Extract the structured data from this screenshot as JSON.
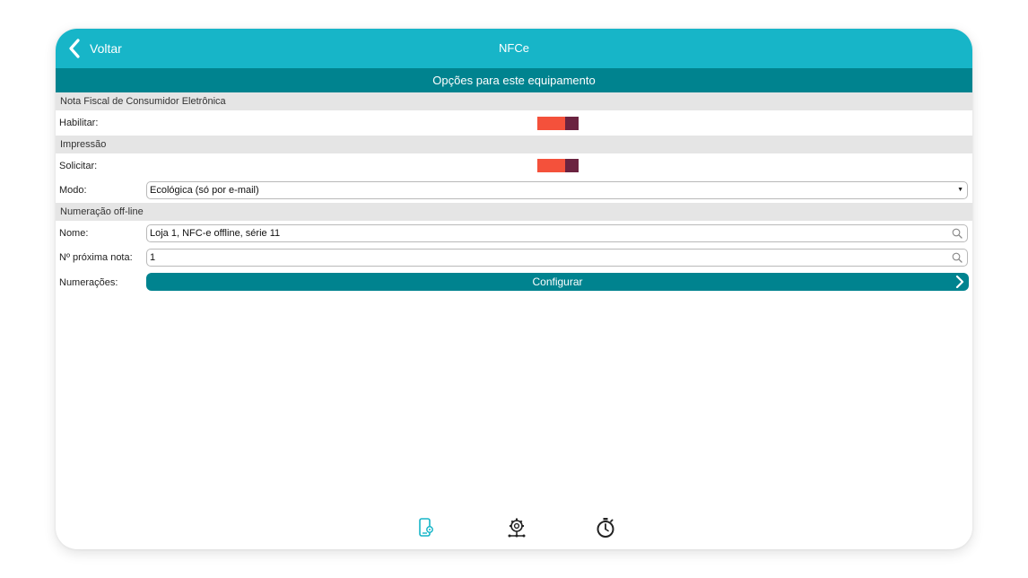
{
  "header": {
    "back_label": "Voltar",
    "title": "NFCe",
    "bg_color": "#17b5c8"
  },
  "subheader": {
    "title": "Opções para este equipamento",
    "bg_color": "#00838f"
  },
  "sections": {
    "nfce": {
      "title": "Nota Fiscal de Consumidor Eletrônica",
      "habilitar_label": "Habilitar:",
      "habilitar_on": true
    },
    "impressao": {
      "title": "Impressão",
      "solicitar_label": "Solicitar:",
      "solicitar_on": true,
      "modo_label": "Modo:",
      "modo_value": "Ecológica (só por e-mail)"
    },
    "numeracao": {
      "title": "Numeração off-line",
      "nome_label": "Nome:",
      "nome_value": "Loja 1, NFC-e offline, série 11",
      "proxima_label": "Nº próxima nota:",
      "proxima_value": "1",
      "numeracoes_label": "Numerações:",
      "configurar_label": "Configurar"
    }
  },
  "toggle_colors": {
    "on": "#f4513b",
    "knob": "#6b2340"
  },
  "tabbar": {
    "items": [
      {
        "icon": "device-settings-icon",
        "active": true
      },
      {
        "icon": "network-gear-icon",
        "active": false
      },
      {
        "icon": "stopwatch-icon",
        "active": false
      }
    ]
  }
}
